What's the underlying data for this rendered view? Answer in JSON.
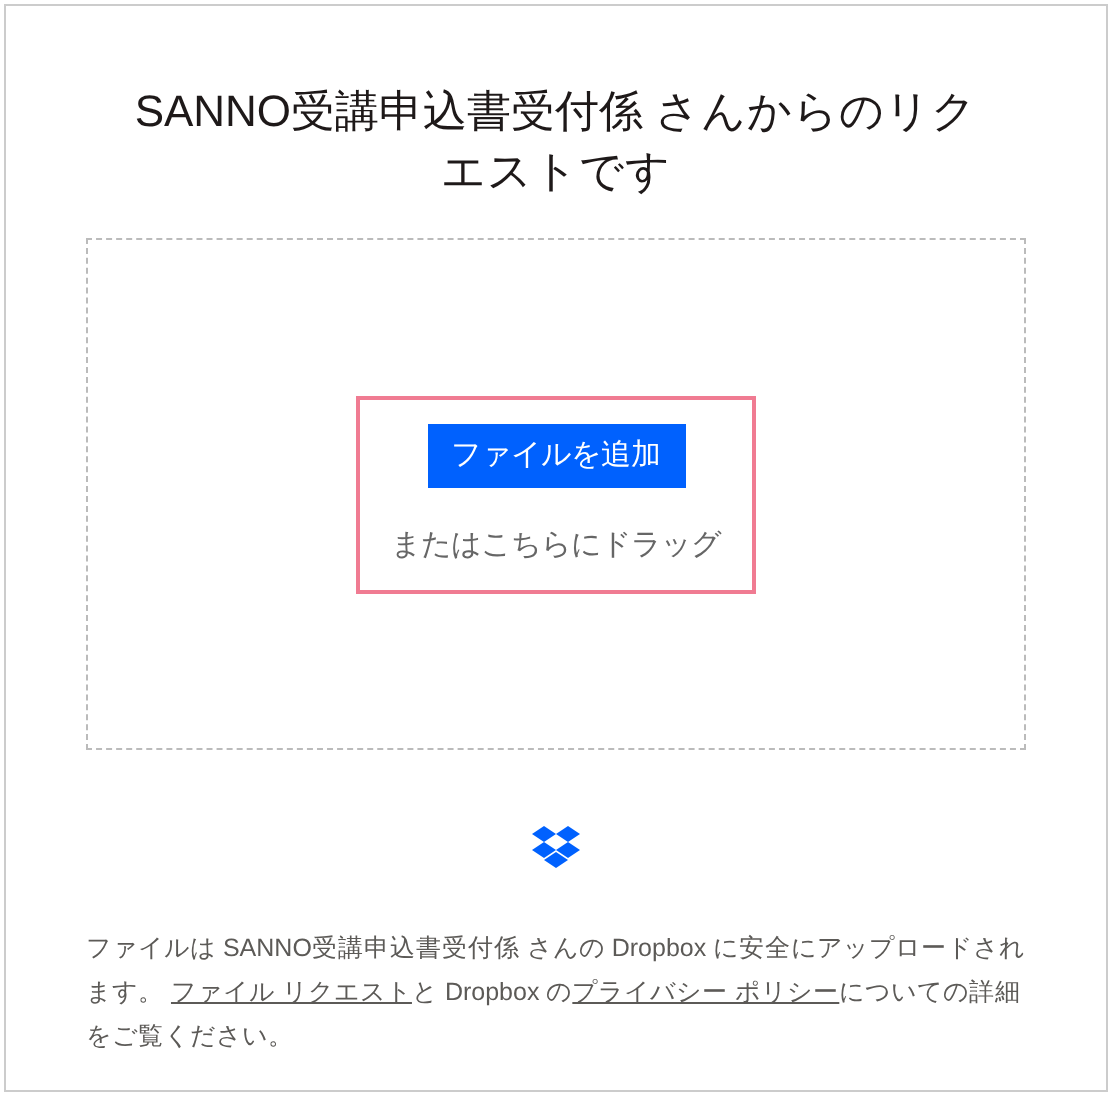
{
  "title": "SANNO受講申込書受付係 さんからのリクエストです",
  "dropzone": {
    "button": "ファイルを追加",
    "hint": "またはこちらにドラッグ",
    "highlighted": true
  },
  "footer": [
    {
      "kind": "text",
      "text": "ファイルは SANNO受講申込書受付係 さんの Dropbox に安全にアップロードされます。 "
    },
    {
      "kind": "link",
      "text": "ファイル リクエスト"
    },
    {
      "kind": "text",
      "text": "と Dropbox の"
    },
    {
      "kind": "link",
      "text": "プライバシー ポリシー"
    },
    {
      "kind": "text",
      "text": "についての詳細をご覧ください。"
    }
  ]
}
